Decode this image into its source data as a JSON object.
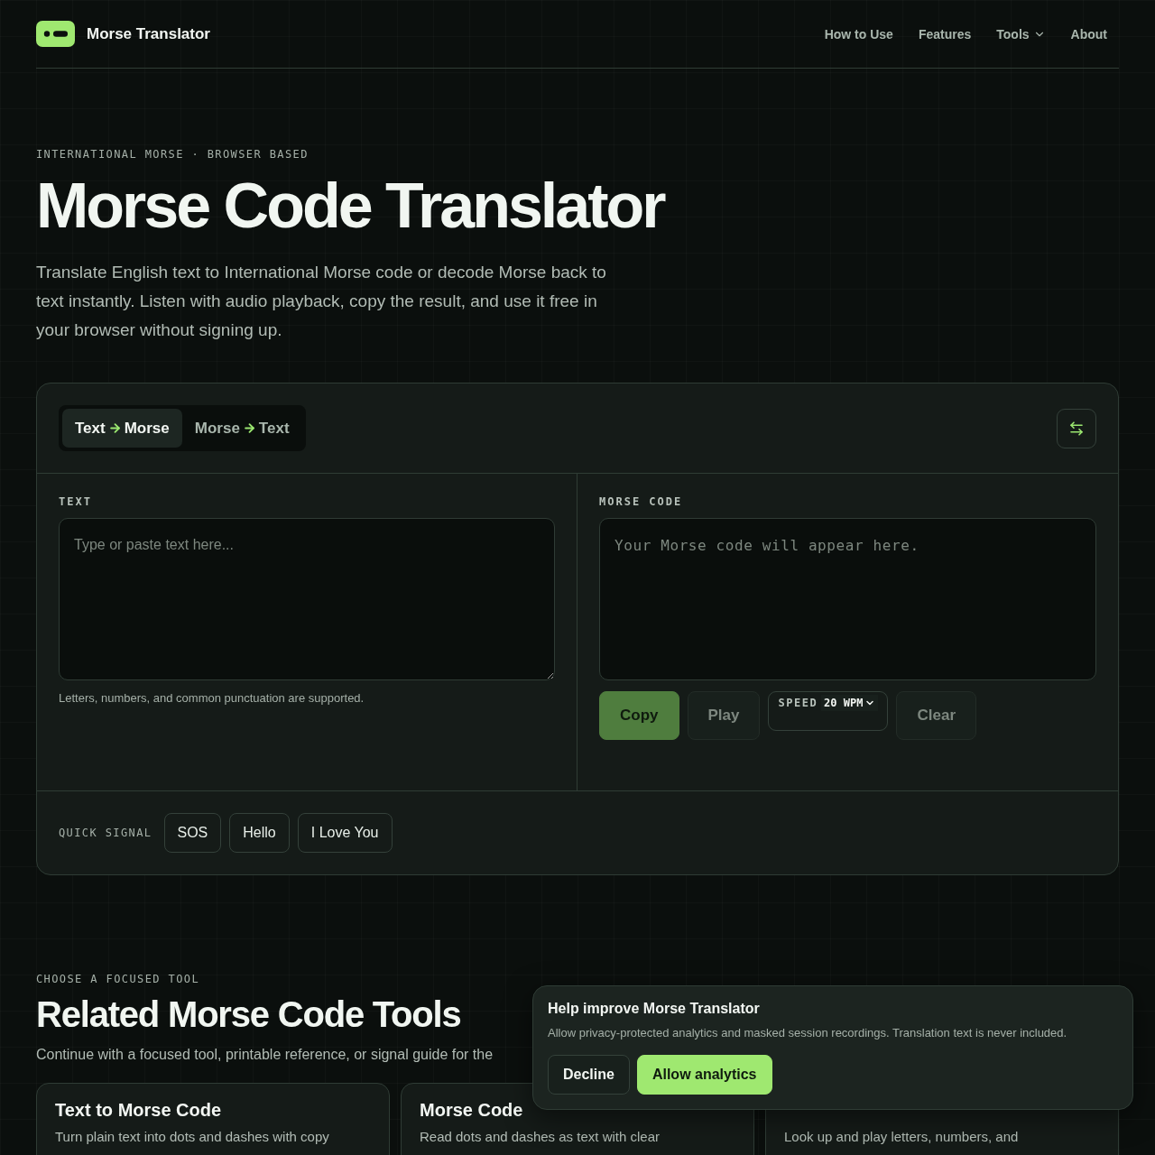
{
  "nav": {
    "brand": "Morse Translator",
    "links": [
      {
        "label": "How to Use",
        "kind": "link"
      },
      {
        "label": "Features",
        "kind": "link"
      },
      {
        "label": "Tools",
        "kind": "dropdown"
      },
      {
        "label": "About",
        "kind": "link"
      }
    ]
  },
  "hero": {
    "eyebrow": "INTERNATIONAL MORSE · BROWSER BASED",
    "title": "Morse Code Translator",
    "description": "Translate English text to International Morse code or decode Morse back to text instantly. Listen with audio playback, copy the result, and use it free in your browser without signing up."
  },
  "translator": {
    "modes": [
      {
        "from": "Text",
        "to": "Morse",
        "selected": true
      },
      {
        "from": "Morse",
        "to": "Text",
        "selected": false
      }
    ],
    "input": {
      "label": "TEXT",
      "placeholder": "Type or paste text here...",
      "hint": "Letters, numbers, and common punctuation are supported."
    },
    "output": {
      "label": "MORSE CODE",
      "placeholder": "Your Morse code will appear here."
    },
    "actions": [
      {
        "kind": "button",
        "label": "Copy",
        "primary": true,
        "disabled": false
      },
      {
        "kind": "button",
        "label": "Play",
        "primary": false,
        "disabled": true
      },
      {
        "kind": "speed",
        "label": "SPEED",
        "value": "20 WPM"
      },
      {
        "kind": "button",
        "label": "Clear",
        "primary": false,
        "disabled": true
      }
    ],
    "quick_signal": {
      "label": "QUICK SIGNAL",
      "items": [
        "SOS",
        "Hello",
        "I Love You"
      ]
    }
  },
  "related": {
    "eyebrow": "CHOOSE A FOCUSED TOOL",
    "title": "Related Morse Code Tools",
    "description": "Continue with a focused tool, printable reference, or signal guide for the",
    "cards": [
      {
        "title": "Text to Morse Code",
        "description": "Turn plain text into dots and dashes with copy"
      },
      {
        "title": "Morse Code",
        "description": "Read dots and dashes as text with clear"
      },
      {
        "description": "Look up and play letters, numbers, and"
      }
    ]
  },
  "consent": {
    "title": "Help improve Morse Translator",
    "text": "Allow privacy-protected analytics and masked session recordings. Translation text is never included.",
    "buttons": [
      {
        "label": "Decline",
        "primary": false
      },
      {
        "label": "Allow analytics",
        "primary": true
      }
    ]
  }
}
